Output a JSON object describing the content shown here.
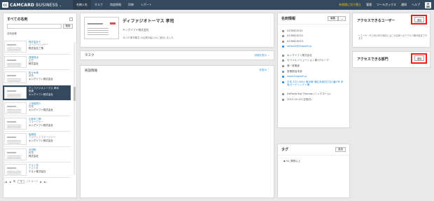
{
  "app": {
    "mark": "CC",
    "brand": "CAMCARD",
    "brand_suffix": "BUSINESS",
    "menu_icon": "menu-chevron-icon"
  },
  "nav": {
    "items": [
      "名刺入れ",
      "タスク",
      "商談情報",
      "同僚",
      "レポート"
    ]
  },
  "header": {
    "upgrade": "有償版に切り替え",
    "links": [
      "管理",
      "ツールボックス",
      "通知",
      "ヘルプ"
    ]
  },
  "left": {
    "title": "すべての名刺",
    "search_button": "検索",
    "sort_label": "名刺画像",
    "page_prefix": "第",
    "page_value": "1",
    "page_suffix": "/ 3 ページ"
  },
  "cards": [
    {
      "name": "株式会社テ",
      "sub": "スーパーバイザー",
      "company": "株式会社三角"
    },
    {
      "name": "西岡真太",
      "sub": "主任",
      "company": "株式会社"
    },
    {
      "name": "佐々木恭",
      "sub": "部長",
      "company": "キングソフト株式会社"
    },
    {
      "name": "ディファジオトーマス 孝司",
      "sub": "役員",
      "company": "キングソフト株式会社"
    },
    {
      "name": "上田裕賀人",
      "sub": "役員",
      "company": "キングソフト株式会社"
    },
    {
      "name": "小林本三朗",
      "sub": "マネージャー",
      "company": "キングソフト株式会社"
    },
    {
      "name": "高橋真",
      "sub": "アカウントマネージャー",
      "company": "キングソフト株式会社"
    },
    {
      "name": "石田鋭",
      "sub": "役員",
      "company": "株式会社"
    },
    {
      "name": "テスト花",
      "sub": "テスト社",
      "company": "テスト株式会社"
    }
  ],
  "main": {
    "person": "ディファジオトーマス 孝司",
    "company": "キングソフト株式会社",
    "meta": "10-19 董本義文 の企業の組入れに追加しました",
    "task_title": "タスク",
    "task_link": "詳細を表示",
    "business_title": "商談情報",
    "business_link": "非表示"
  },
  "info": {
    "title": "名刺情報",
    "edit": "編集",
    "phones": [
      "0335620231",
      "0335620232",
      "0335620233"
    ],
    "email": "defazio@kingsoft.jp",
    "company": "キングソフト株式会社",
    "division": "モバイルソリューション第1グループ",
    "dept": "第一営業部",
    "title_role": "営業統括本部",
    "url": "www.kingsoft.jp",
    "address": "日本 107-0052 東京都 港区赤坂四丁目1番1号 赤坂ガーデンシティ棟",
    "nickname": "DeFazio Koji Thomas (ニックネーム)",
    "date": "2015-10-19 (交換日)"
  },
  "tag": {
    "title": "タグ",
    "add": "追加",
    "item": "04_課長以上"
  },
  "access_user": {
    "title": "アクセスできるユーザー",
    "add": "追加",
    "note": "* ユーザーが上司以外の場合にはこの名刺へのアクセス権が設定できます"
  },
  "access_dept": {
    "title": "アクセスできる部門",
    "add": "追加"
  }
}
